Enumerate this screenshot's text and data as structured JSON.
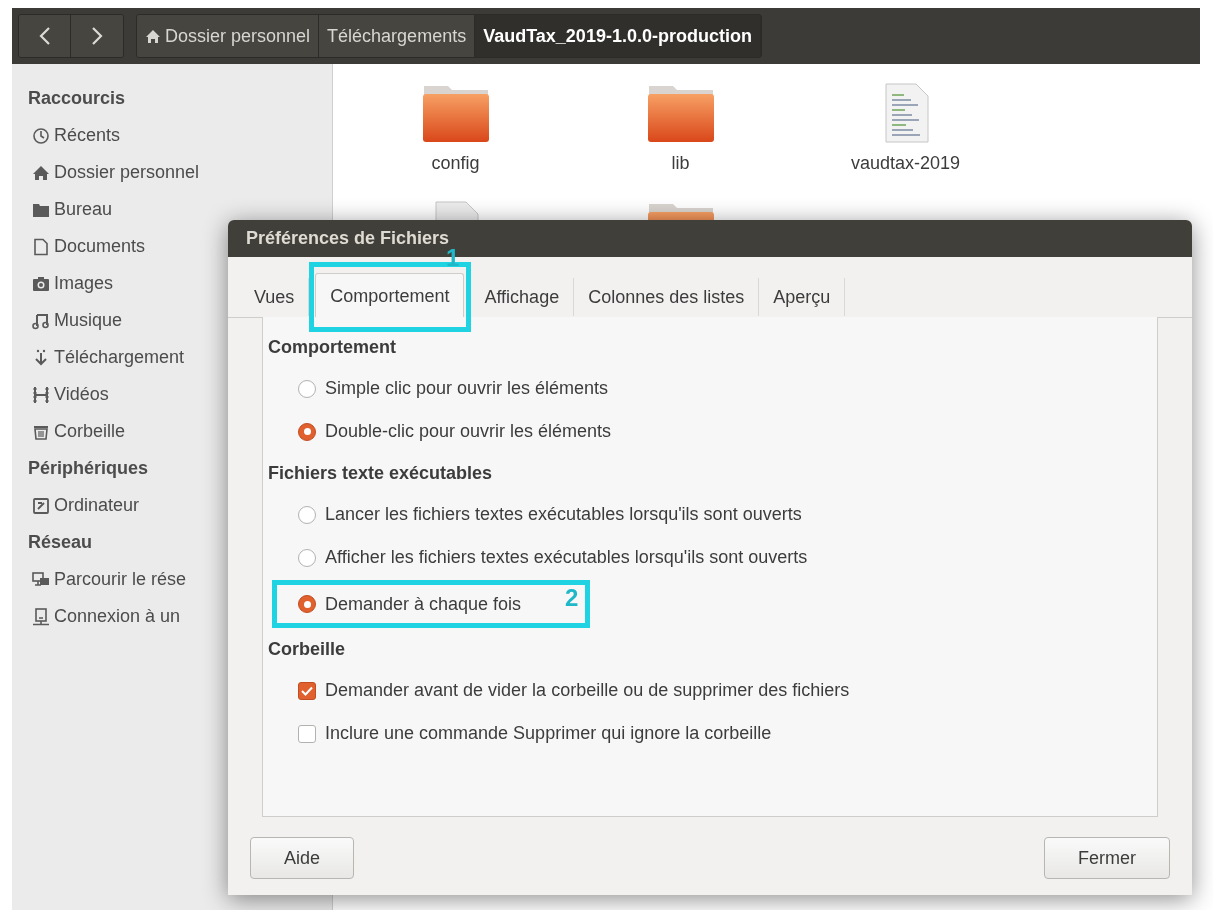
{
  "toolbar": {
    "breadcrumbs": [
      {
        "label": "Dossier personnel",
        "selected": false
      },
      {
        "label": "Téléchargements",
        "selected": false
      },
      {
        "label": "VaudTax_2019-1.0.0-production",
        "selected": true
      }
    ]
  },
  "sidebar": {
    "sections": [
      {
        "title": "Raccourcis",
        "items": [
          "Récents",
          "Dossier personnel",
          "Bureau",
          "Documents",
          "Images",
          "Musique",
          "Téléchargement",
          "Vidéos",
          "Corbeille"
        ]
      },
      {
        "title": "Périphériques",
        "items": [
          "Ordinateur"
        ]
      },
      {
        "title": "Réseau",
        "items": [
          "Parcourir le rése",
          "Connexion à un"
        ]
      }
    ]
  },
  "files": [
    {
      "name": "config",
      "kind": "folder"
    },
    {
      "name": "lib",
      "kind": "folder"
    },
    {
      "name": "vaudtax-2019",
      "kind": "text"
    },
    {
      "kind": "script"
    },
    {
      "kind": "folder"
    }
  ],
  "dialog": {
    "title": "Préférences de Fichiers",
    "tabs": [
      {
        "label": "Vues",
        "selected": false
      },
      {
        "label": "Comportement",
        "selected": true
      },
      {
        "label": "Affichage",
        "selected": false
      },
      {
        "label": "Colonnes des listes",
        "selected": false
      },
      {
        "label": "Aperçu",
        "selected": false
      }
    ],
    "sections": [
      {
        "title": "Comportement",
        "options": [
          {
            "kind": "radio",
            "label": "Simple clic pour ouvrir les éléments",
            "checked": false
          },
          {
            "kind": "radio",
            "label": "Double-clic pour ouvrir les éléments",
            "checked": true
          }
        ]
      },
      {
        "title": "Fichiers texte exécutables",
        "options": [
          {
            "kind": "radio",
            "label": "Lancer les fichiers textes exécutables lorsqu'ils sont ouverts",
            "checked": false
          },
          {
            "kind": "radio",
            "label": "Afficher les fichiers textes exécutables lorsqu'ils sont ouverts",
            "checked": false
          },
          {
            "kind": "radio",
            "label": "Demander à chaque fois",
            "checked": true
          }
        ]
      },
      {
        "title": "Corbeille",
        "options": [
          {
            "kind": "checkbox",
            "label": "Demander avant de vider la corbeille ou de supprimer des fichiers",
            "checked": true
          },
          {
            "kind": "checkbox",
            "label": "Inclure une commande Supprimer qui ignore la corbeille",
            "checked": false
          }
        ]
      }
    ],
    "buttons": [
      "Aide",
      "Fermer"
    ]
  },
  "annotations": [
    {
      "number": "1"
    },
    {
      "number": "2"
    }
  ]
}
